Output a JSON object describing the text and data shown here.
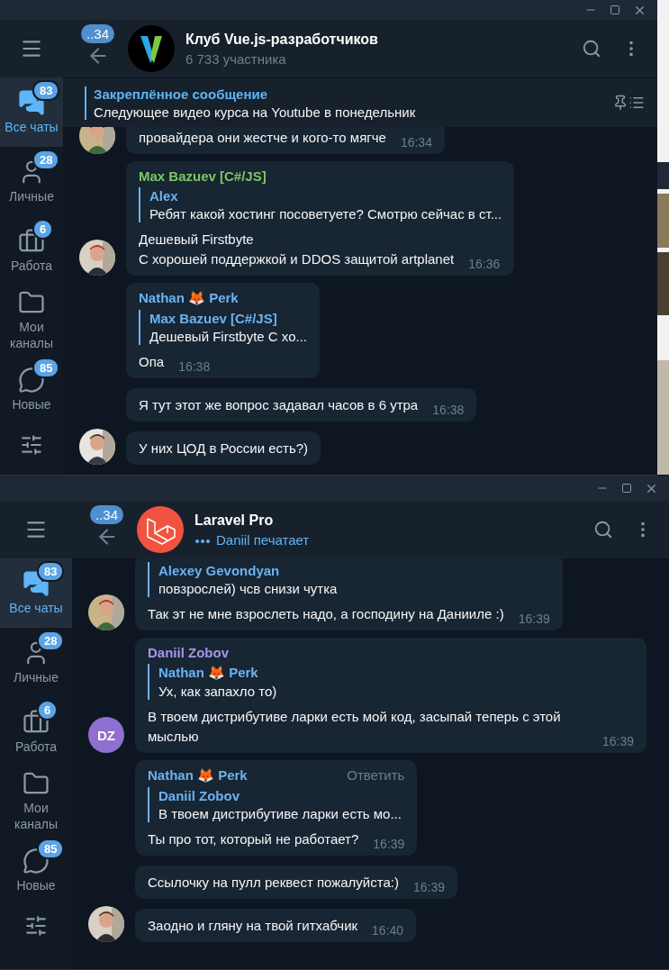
{
  "windows": [
    {
      "header": {
        "back_badge": "..34",
        "title": "Клуб Vue.js-разработчиков",
        "subtitle": {
          "kind": "members",
          "text": "6 733 участника"
        }
      },
      "pinned": {
        "label": "Закреплённое сообщение",
        "text": "Следующее видео курса на Youtube в понедельник"
      },
      "folders": [
        {
          "label": "Все чаты",
          "badge": "83",
          "selected": true
        },
        {
          "label": "Личные",
          "badge": "28",
          "selected": false
        },
        {
          "label": "Работа",
          "badge": "6",
          "selected": false
        },
        {
          "label": "Мои каналы",
          "selected": false
        },
        {
          "label": "Новые",
          "badge": "85",
          "selected": false
        }
      ],
      "messages": [
        {
          "text": "провайдера они жестче и кого-то мягче",
          "time": "16:34"
        },
        {
          "sender": "Max Bazuev [C#/JS]",
          "color": "#7bc862",
          "reply": {
            "name": "Alex",
            "text": "Ребят какой хостинг посоветуете? Смотрю сейчас в ст..."
          },
          "text": "Дешевый Firstbyte\nС хорошей поддержкой и DDOS защитой artplanet",
          "time": "16:36"
        },
        {
          "sender": "Nathan 🦊 Perk",
          "color": "#6ab3f3",
          "reply": {
            "name": "Max Bazuev [C#/JS]",
            "text": "Дешевый Firstbyte С хо..."
          },
          "text": "Опа",
          "time": "16:38"
        },
        {
          "text": "Я тут этот же вопрос задавал часов в 6 утра",
          "time": "16:38"
        },
        {
          "text": "У них ЦОД в России есть?)"
        }
      ]
    },
    {
      "header": {
        "back_badge": "..34",
        "title": "Laravel Pro",
        "subtitle": {
          "kind": "typing",
          "text": "Daniil печатает"
        }
      },
      "folders": [
        {
          "label": "Все чаты",
          "badge": "83",
          "selected": true
        },
        {
          "label": "Личные",
          "badge": "28",
          "selected": false
        },
        {
          "label": "Работа",
          "badge": "6",
          "selected": false
        },
        {
          "label": "Мои каналы",
          "selected": false
        },
        {
          "label": "Новые",
          "badge": "85",
          "selected": false
        }
      ],
      "messages": [
        {
          "reply": {
            "name": "Alexey Gevondyan",
            "text": "повзрослей) чсв снизи чутка"
          },
          "text": "Так эт не мне взрослеть надо, а господину на Данииле :)",
          "time": "16:39"
        },
        {
          "sender": "Daniil Zobov",
          "color": "#a695e7",
          "reply": {
            "name": "Nathan 🦊 Perk",
            "text": "Ух, как запахло то)"
          },
          "text": "В твоем дистрибутиве ларки есть мой код, засыпай теперь с этой мыслью",
          "time": "16:39",
          "avatar": {
            "kind": "initials",
            "initials": "DZ",
            "color": "#8f6fd0"
          }
        },
        {
          "sender": "Nathan 🦊 Perk",
          "color": "#6ab3f3",
          "action": "Ответить",
          "reply": {
            "name": "Daniil Zobov",
            "text": "В твоем дистрибутиве ларки есть мо..."
          },
          "text": "Ты про тот, который не работает?",
          "time": "16:39"
        },
        {
          "text": "Ссылочку на пулл реквест пожалуйста:)",
          "time": "16:39"
        },
        {
          "text": "Заодно и гляну на твой гитхабчик",
          "time": "16:40"
        }
      ]
    }
  ]
}
